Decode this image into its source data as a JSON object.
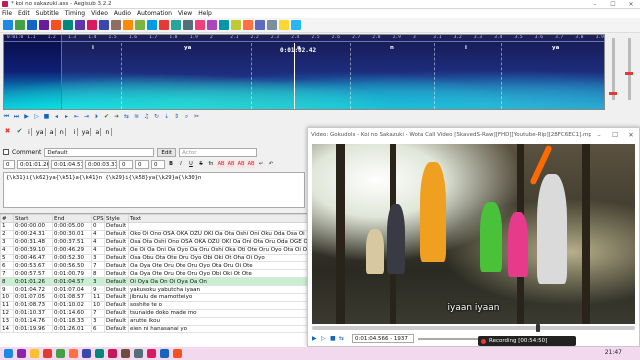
{
  "window": {
    "title": "* koi no sakazuki.ass - Aegisub 3.2.2",
    "min": "–",
    "max": "☐",
    "close": "✕"
  },
  "menu": [
    "File",
    "Edit",
    "Subtitle",
    "Timing",
    "Video",
    "Audio",
    "Automation",
    "View",
    "Help"
  ],
  "toolbar": {
    "icons": [
      "new-file-icon",
      "open-file-icon",
      "save-icon",
      "save-as-icon",
      "open-video-icon",
      "open-audio-icon",
      "properties-icon",
      "styles-icon",
      "attachments-icon",
      "fonts-icon",
      "find-icon",
      "replace-icon",
      "jump-icon",
      "zoom-icon",
      "select-icon",
      "shift-times-icon",
      "timing-postprocessor-icon",
      "kanji-timer-icon",
      "resample-icon",
      "spell-check-icon",
      "automation-icon",
      "translation-icon",
      "options-icon",
      "lock-icon",
      "help-icon"
    ]
  },
  "audio": {
    "ruler_ticks": [
      "0:01:0",
      "1.1",
      "1.2",
      "1.3",
      "1.4",
      "1.5",
      "1.6",
      "1.7",
      "1.8",
      "1.9",
      "2",
      "2.1",
      "2.2",
      "2.3",
      "2.4",
      "2.5",
      "2.6",
      "2.7",
      "2.8",
      "2.9",
      "3",
      "3.1",
      "3.2",
      "3.3",
      "3.4",
      "3.5",
      "3.6",
      "3.7",
      "3.8",
      "3.9"
    ],
    "cursor_time": "0:01:02.42",
    "syllables": [
      "i",
      "ya",
      "a",
      "n",
      "i",
      "ya"
    ]
  },
  "karaoke": {
    "syllables": [
      "i",
      "ya",
      "a",
      "n",
      "i",
      "ya",
      "a",
      "n"
    ]
  },
  "edit": {
    "comment_label": "Comment",
    "style": "Default",
    "edit_btn": "Edit",
    "actor_placeholder": "Actor",
    "layer": "0",
    "start": "0:01:01.26",
    "end": "0:01:04.57",
    "duration": "0:00:03.31",
    "margin_l": "0",
    "margin_r": "0",
    "margin_v": "0",
    "time_label": "Time",
    "frame_label": "Frame",
    "format_buttons": [
      "B",
      "I",
      "U",
      "S",
      "fn",
      "AB",
      "AB",
      "AB",
      "AB",
      "↵",
      "↶"
    ],
    "text": "{\\k31}i{\\k62}ya{\\k51}a{\\k41}n {\\k29}i{\\k58}ya{\\k29}a{\\k30}n"
  },
  "grid": {
    "headers": [
      "#",
      "Start",
      "End",
      "CPS",
      "Style",
      "Text"
    ],
    "rows": [
      {
        "n": "1",
        "start": "0:00:00.00",
        "end": "0:00:05.00",
        "cps": "0",
        "style": "Default",
        "text": ""
      },
      {
        "n": "2",
        "start": "0:00:24.31",
        "end": "0:00:30.01",
        "cps": "4",
        "style": "Default",
        "text": "Oko Oi Ono OSA OKA OZU OKI Oa Ota Oshi Oni Oku Oda Osa Oi"
      },
      {
        "n": "3",
        "start": "0:00:31.48",
        "end": "0:00:37.51",
        "cps": "4",
        "style": "Default",
        "text": "Osa Ota Oshi Ono OSA OKA OZU OKI Oa Oni Ota Oru Oda OGE ORU Oyo"
      },
      {
        "n": "4",
        "start": "0:00:39.10",
        "end": "0:00:46.29",
        "cps": "4",
        "style": "Default",
        "text": "Oe Oi Oa Oni Oa Oyo Oa Oru Oshi Oka Oti Ote Oru Oyo Ota Oi Oyo"
      },
      {
        "n": "5",
        "start": "0:00:46.47",
        "end": "0:00:52.30",
        "cps": "3",
        "style": "Default",
        "text": "Osa Obu Ota Ote Oru Oyo Obi Oki Ot Oha Oi Oyo"
      },
      {
        "n": "6",
        "start": "0:00:53.67",
        "end": "0:00:56.50",
        "cps": "7",
        "style": "Default",
        "text": "Oa Oya Ote Oru Ote Oru Oyo Ota Oru Oi Ote"
      },
      {
        "n": "7",
        "start": "0:00:57.57",
        "end": "0:01:00.79",
        "cps": "8",
        "style": "Default",
        "text": "Oa Oya Ote Oru Ote Oru Oyo Obi Oki Ot Ote"
      },
      {
        "n": "8",
        "start": "0:01:01.26",
        "end": "0:01:04.57",
        "cps": "3",
        "style": "Default",
        "text": "Oi Oya Oa On Oi Oya Oa On"
      },
      {
        "n": "9",
        "start": "0:01:04.72",
        "end": "0:01:07.04",
        "cps": "9",
        "style": "Default",
        "text": "yakusoku yabutcha iyaan"
      },
      {
        "n": "10",
        "start": "0:01:07.05",
        "end": "0:01:08.57",
        "cps": "11",
        "style": "Default",
        "text": "jibnulu de mamotteiyo"
      },
      {
        "n": "11",
        "start": "0:01:08.73",
        "end": "0:01:10.02",
        "cps": "10",
        "style": "Default",
        "text": "soshite te o"
      },
      {
        "n": "12",
        "start": "0:01:10.37",
        "end": "0:01:14.60",
        "cps": "7",
        "style": "Default",
        "text": "tsunaide doko made mo"
      },
      {
        "n": "13",
        "start": "0:01:14.76",
        "end": "0:01:18.33",
        "cps": "3",
        "style": "Default",
        "text": "arutte ikou"
      },
      {
        "n": "14",
        "start": "0:01:19.96",
        "end": "0:01:26.01",
        "cps": "6",
        "style": "Default",
        "text": "eien ni hanasanai yo"
      }
    ]
  },
  "video": {
    "title": "Video: Gokudols - Koi no Sakazuki - Wota Call Video [SkavedS-Raw][FHD][Youtube-Rip][28FC6EC1].mp4",
    "subtitle": "iyaan iyaan",
    "time": "0:01:04.566 - 1937",
    "progress": 0.7
  },
  "recording": {
    "label": "Recording [00:54:50]"
  },
  "taskbar": {
    "clock": "21:47"
  }
}
